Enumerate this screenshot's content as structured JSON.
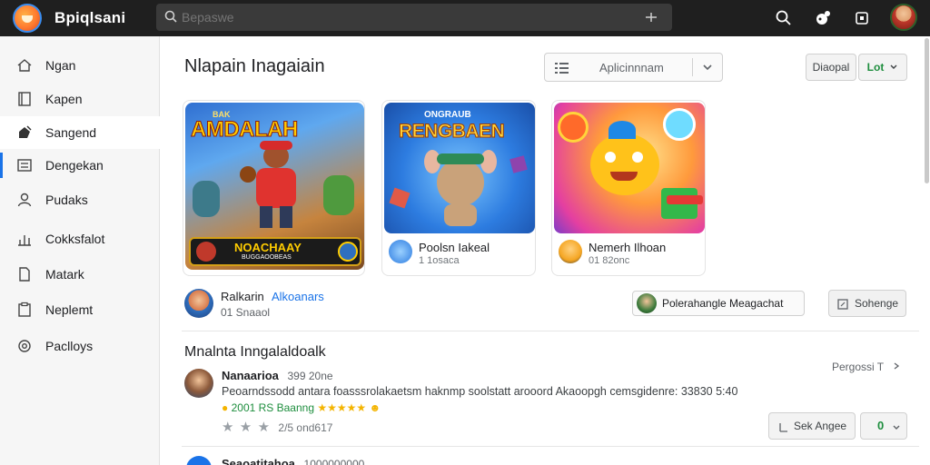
{
  "topbar": {
    "app_title": "Bpiqlsani",
    "search_placeholder": "Bepaswe"
  },
  "sidebar": {
    "items": [
      {
        "label": "Ngan",
        "icon": "home-icon"
      },
      {
        "label": "Kapen",
        "icon": "book-icon"
      },
      {
        "label": "Sangend",
        "icon": "sparkle-icon"
      },
      {
        "label": "Dengekan",
        "icon": "list-icon"
      },
      {
        "label": "Pudaks",
        "icon": "user-icon"
      },
      {
        "label": "Cokksfalot",
        "icon": "chart-icon"
      },
      {
        "label": "Matark",
        "icon": "document-icon"
      },
      {
        "label": "Neplemt",
        "icon": "clipboard-icon"
      },
      {
        "label": "Paclloys",
        "icon": "settings-icon"
      }
    ]
  },
  "main": {
    "title": "Nlapain Inagaiain",
    "dropdown_label": "Aplicinnnam",
    "filter_button": "Diaopal",
    "lot_button": "Lot",
    "cards": [
      {
        "banner_top": "BAK",
        "banner_title": "AMDALAH",
        "banner_bottom": "NOACHAAY",
        "banner_caption": "BUGGAOOBEAS"
      },
      {
        "banner_top": "ONGRAUB",
        "banner_title": "RENGBAEN",
        "title": "Poolsn Iakeal",
        "subtitle": "1 1osaca"
      },
      {
        "title": "Nemerh Ilhoan",
        "subtitle": "01 82onc"
      }
    ],
    "developer": {
      "name": "Ralkarin",
      "link": "Alkoanars",
      "subtitle": "01 Snaaol",
      "promo_label": "Polerahangle Meagachat",
      "button": "Sohenge"
    },
    "reviews_section_title": "Mnalnta Inngalaldoalk",
    "reviews_more": "Pergossi T",
    "review": {
      "author": "Nanaarioa",
      "date": "399 20ne",
      "text": "Peoarndssodd antara foasssrolakaetsm haknmp soolstatt arooord Akaoopgh cemsgidenre: 33830 5:40",
      "badge_text": "2001 RS Baanng",
      "stars_text": "2/5 ond617",
      "reply_button": "Sek Angee",
      "helpful_count": "0"
    },
    "next_review_author": "Seaoatitahoa",
    "next_review_date": "1000000000"
  },
  "colors": {
    "topbar_bg": "#1f1f1f",
    "accent_blue": "#1a73e8",
    "green": "#1e8e3e",
    "star": "#f4b400"
  }
}
